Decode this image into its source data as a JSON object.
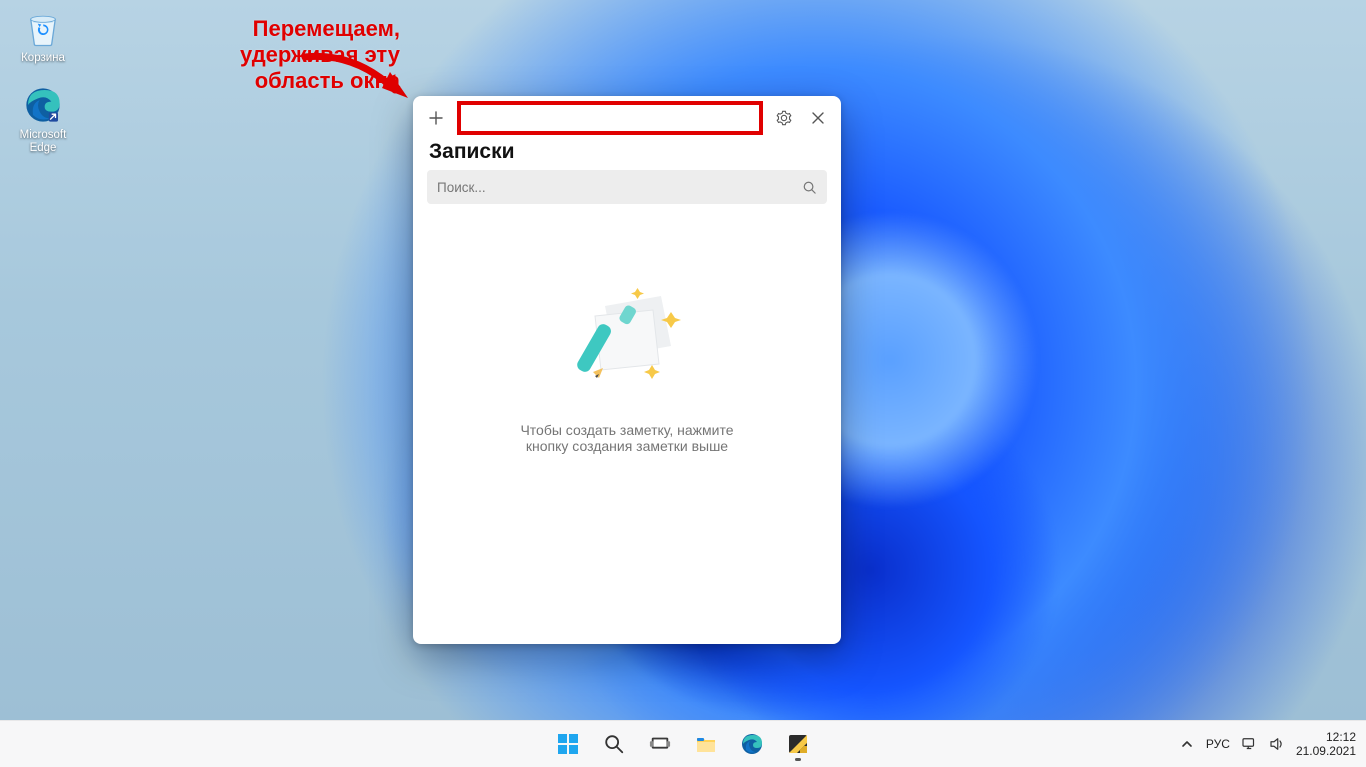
{
  "desktop": {
    "icons": [
      {
        "name": "recycle-bin",
        "label": "Корзина"
      },
      {
        "name": "microsoft-edge",
        "label": "Microsoft Edge"
      }
    ]
  },
  "annotation": {
    "line1": "Перемещаем,",
    "line2": "удерживая эту",
    "line3": "область окна"
  },
  "window": {
    "title": "Записки",
    "search_placeholder": "Поиск...",
    "empty_line1": "Чтобы создать заметку, нажмите",
    "empty_line2": "кнопку создания заметки выше"
  },
  "taskbar": {
    "items": [
      {
        "name": "start"
      },
      {
        "name": "search"
      },
      {
        "name": "task-view"
      },
      {
        "name": "file-explorer"
      },
      {
        "name": "edge"
      },
      {
        "name": "sticky-notes"
      }
    ],
    "language": "РУС",
    "clock_time": "12:12",
    "clock_date": "21.09.2021"
  }
}
